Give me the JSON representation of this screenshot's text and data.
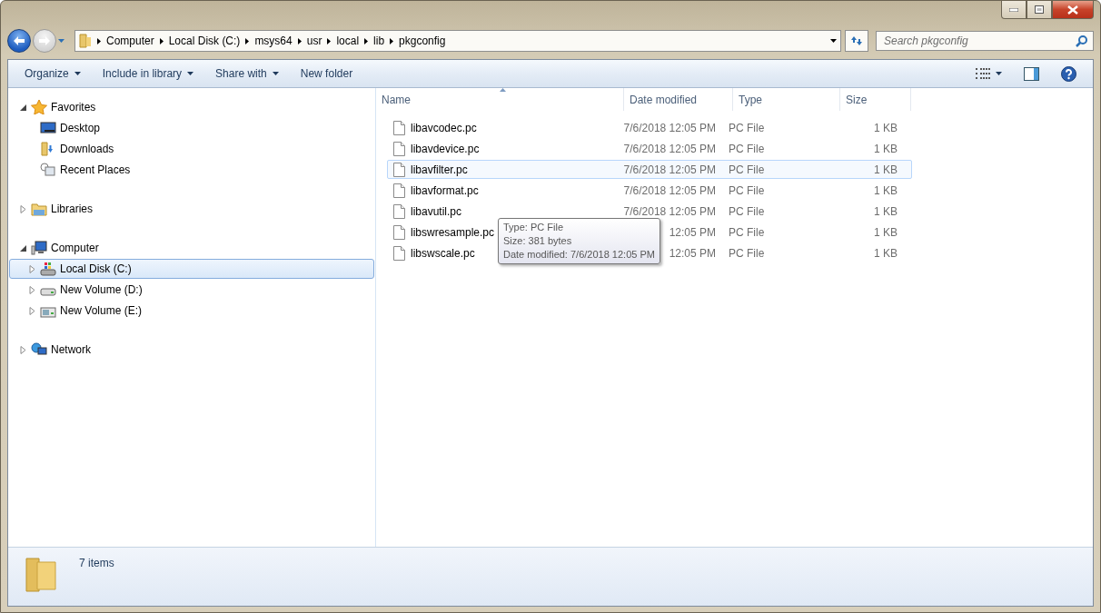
{
  "address": {
    "breadcrumbs": [
      "Computer",
      "Local Disk (C:)",
      "msys64",
      "usr",
      "local",
      "lib",
      "pkgconfig"
    ]
  },
  "search": {
    "placeholder": "Search pkgconfig"
  },
  "toolbar": {
    "items": [
      {
        "label": "Organize",
        "dropdown": true
      },
      {
        "label": "Include in library",
        "dropdown": true
      },
      {
        "label": "Share with",
        "dropdown": true
      },
      {
        "label": "New folder",
        "dropdown": false
      }
    ]
  },
  "navigation": {
    "groups": [
      {
        "label": "Favorites",
        "kind": "star",
        "expanded": true,
        "selected": false,
        "children": [
          {
            "label": "Desktop",
            "kind": "desktop",
            "selected": false
          },
          {
            "label": "Downloads",
            "kind": "download",
            "selected": false
          },
          {
            "label": "Recent Places",
            "kind": "recent",
            "selected": false
          }
        ]
      },
      {
        "label": "Libraries",
        "kind": "library",
        "expanded": false,
        "selected": false
      },
      {
        "label": "Computer",
        "kind": "computer",
        "expanded": true,
        "selected": false,
        "children": [
          {
            "label": "Local Disk (C:)",
            "kind": "system-drive",
            "expanded": false,
            "selected": true
          },
          {
            "label": "New Volume (D:)",
            "kind": "drive",
            "expanded": false,
            "selected": false
          },
          {
            "label": "New Volume (E:)",
            "kind": "media-drive",
            "expanded": false,
            "selected": false
          }
        ]
      },
      {
        "label": "Network",
        "kind": "network",
        "expanded": false,
        "selected": false
      }
    ]
  },
  "file_list": {
    "columns": [
      {
        "label": "Name",
        "sorted": true
      },
      {
        "label": "Date modified",
        "sorted": false
      },
      {
        "label": "Type",
        "sorted": false
      },
      {
        "label": "Size",
        "sorted": false
      }
    ],
    "rows": [
      {
        "name": "libavcodec.pc",
        "date": "7/6/2018 12:05 PM",
        "type": "PC File",
        "size": "1 KB",
        "hovered": false
      },
      {
        "name": "libavdevice.pc",
        "date": "7/6/2018 12:05 PM",
        "type": "PC File",
        "size": "1 KB",
        "hovered": false
      },
      {
        "name": "libavfilter.pc",
        "date": "7/6/2018 12:05 PM",
        "type": "PC File",
        "size": "1 KB",
        "hovered": true
      },
      {
        "name": "libavformat.pc",
        "date": "7/6/2018 12:05 PM",
        "type": "PC File",
        "size": "1 KB",
        "hovered": false
      },
      {
        "name": "libavutil.pc",
        "date": "7/6/2018 12:05 PM",
        "type": "PC File",
        "size": "1 KB",
        "hovered": false
      },
      {
        "name": "libswresample.pc",
        "date": "12:05 PM",
        "type": "PC File",
        "size": "1 KB",
        "hovered": false
      },
      {
        "name": "libswscale.pc",
        "date": "12:05 PM",
        "type": "PC File",
        "size": "1 KB",
        "hovered": false
      }
    ],
    "tooltip": {
      "lines": [
        "Type: PC File",
        "Size: 381 bytes",
        "Date modified: 7/6/2018 12:05 PM"
      ]
    }
  },
  "status_bar": {
    "text": "7 items"
  }
}
